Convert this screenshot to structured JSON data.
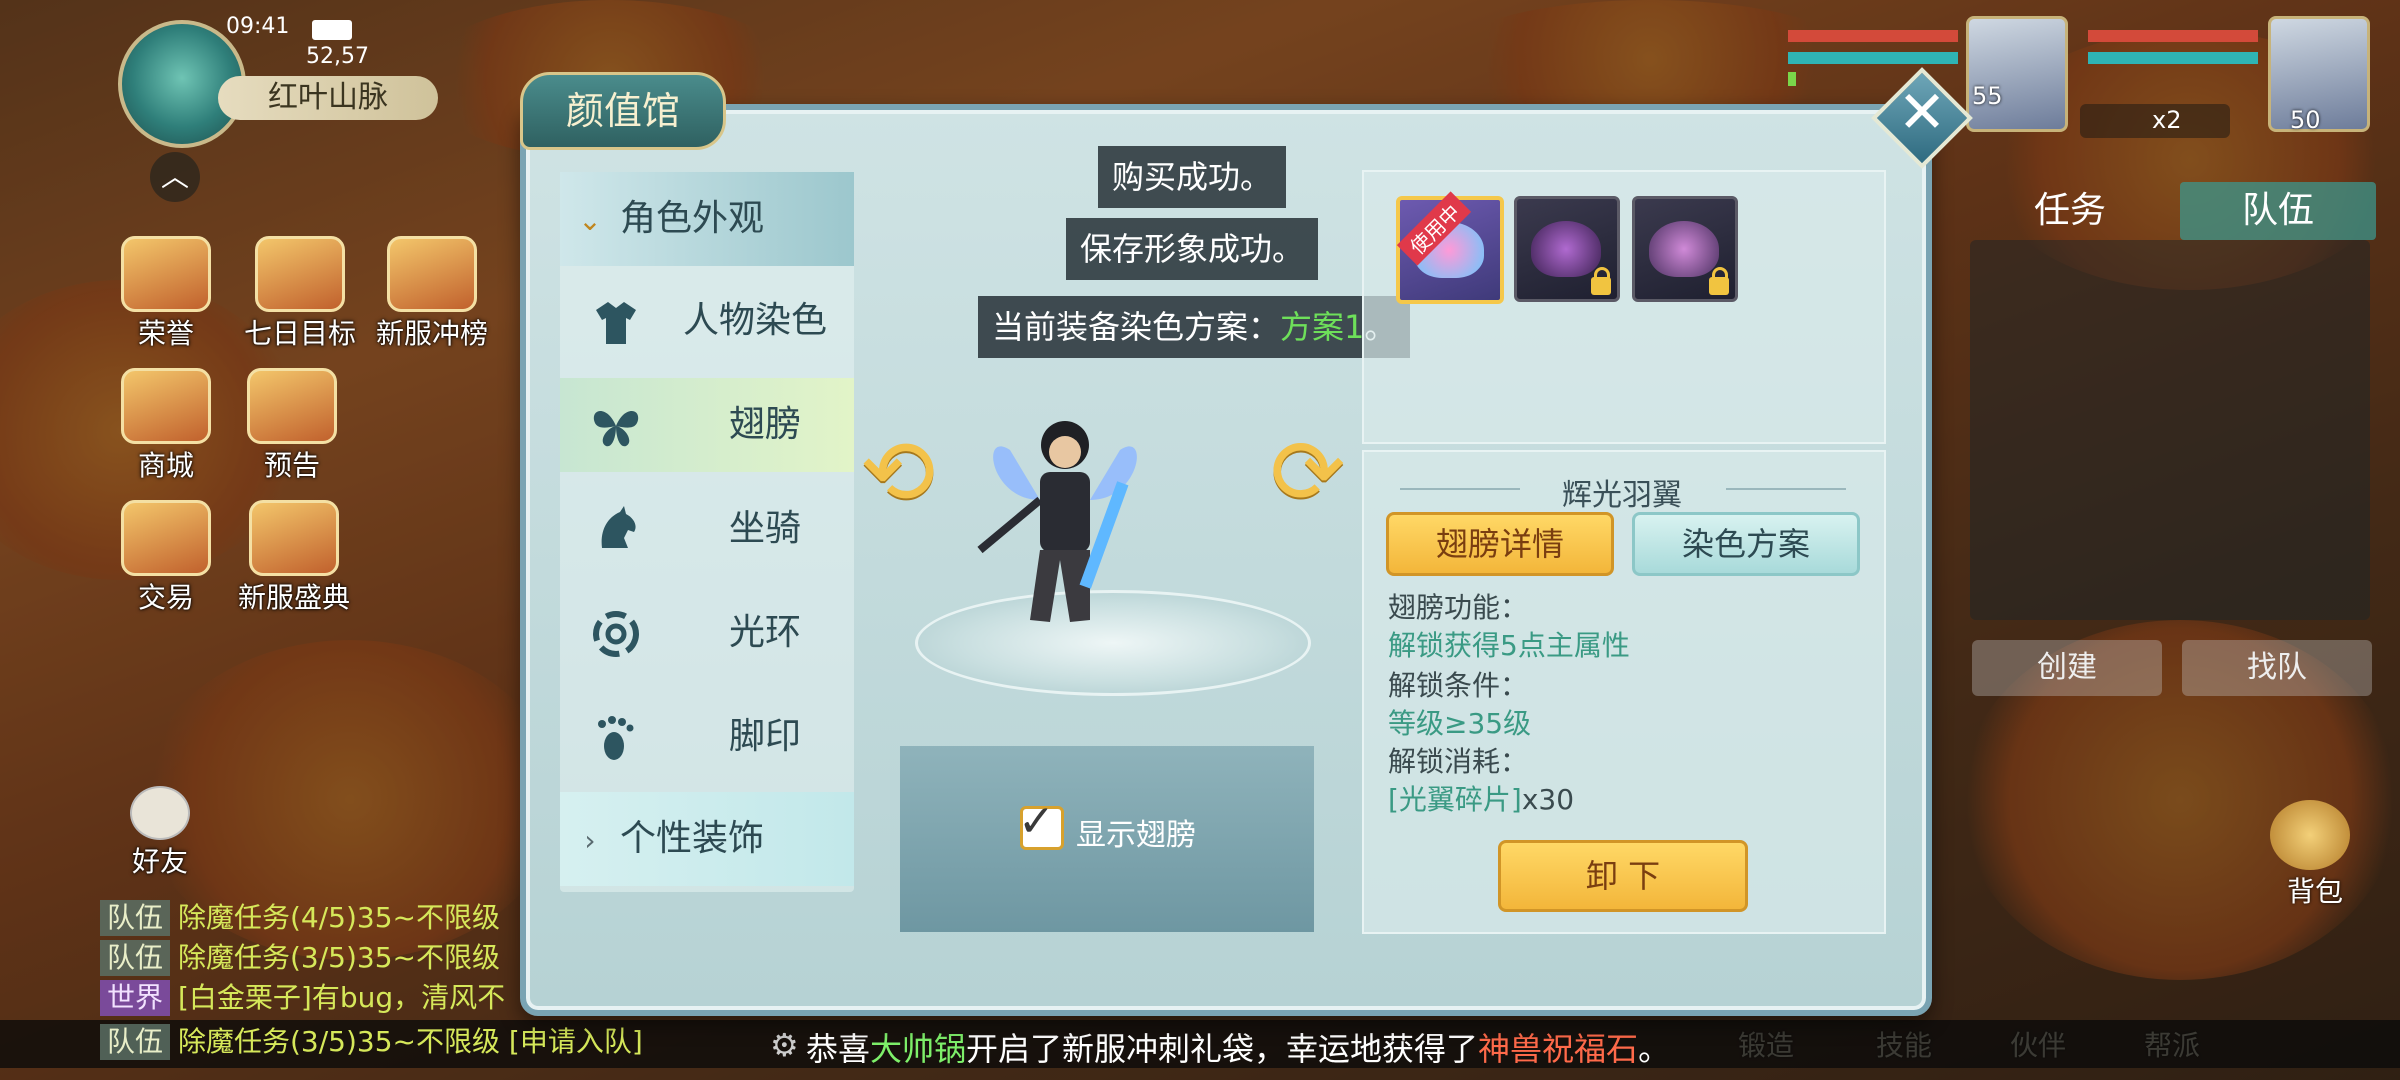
{
  "status_bar": {
    "time": "09:41",
    "coords": "52,57",
    "map_name": "红叶山脉"
  },
  "hud_left": [
    {
      "label": "荣誉"
    },
    {
      "label": "七日目标"
    },
    {
      "label": "新服冲榜"
    },
    {
      "label": "商城"
    },
    {
      "label": "预告"
    },
    {
      "label": "交易"
    },
    {
      "label": "新服盛典"
    }
  ],
  "friends_label": "好友",
  "party": {
    "left_level": "55",
    "right_level": "50",
    "item_count": "x2"
  },
  "side_tabs": {
    "task": "任务",
    "team": "队伍",
    "create": "创建",
    "find": "找队"
  },
  "bag_label": "背包",
  "bottom_nav": [
    "锻造",
    "技能",
    "伙伴",
    "帮派"
  ],
  "chat": [
    {
      "tag": "队伍",
      "text": "除魔任务(4/5)35~不限级",
      "world": false
    },
    {
      "tag": "队伍",
      "text": "除魔任务(3/5)35~不限级",
      "world": false
    },
    {
      "tag": "世界",
      "text": "[白金栗子]有bug，清风不",
      "world": true
    },
    {
      "tag": "队伍",
      "text": "除魔任务(3/5)35~不限级 [申请入队]",
      "world": false
    }
  ],
  "announcement": {
    "part1": "恭喜",
    "name": "大帅锅",
    "part2": "开启了新服冲刺礼袋，幸运地获得了",
    "item": "神兽祝福石",
    "end": "。"
  },
  "panel": {
    "title": "颜值馆",
    "menu": {
      "header": "角色外观",
      "items": [
        {
          "label": "人物染色",
          "icon": "shirt-icon"
        },
        {
          "label": "翅膀",
          "icon": "wings-icon",
          "active": true
        },
        {
          "label": "坐骑",
          "icon": "horse-icon"
        },
        {
          "label": "光环",
          "icon": "halo-icon"
        },
        {
          "label": "脚印",
          "icon": "footprint-icon"
        }
      ],
      "footer": "个性装饰"
    },
    "toasts": {
      "t1": "购买成功。",
      "t2": "保存形象成功。",
      "t3_prefix": "当前装备染色方案：",
      "t3_scheme": "方案1",
      "t3_suffix": "。"
    },
    "show_wings_label": "显示翅膀",
    "in_use_badge": "使用中",
    "wing_name": "辉光羽翼",
    "btn_details": "翅膀详情",
    "btn_dye": "染色方案",
    "info": {
      "func_label": "翅膀功能：",
      "func_value": "解锁获得5点主属性",
      "cond_label": "解锁条件：",
      "cond_value": "等级≥35级",
      "cost_label": "解锁消耗：",
      "cost_item": "[光翼碎片]",
      "cost_qty": "x30"
    },
    "btn_unequip": "卸 下"
  }
}
